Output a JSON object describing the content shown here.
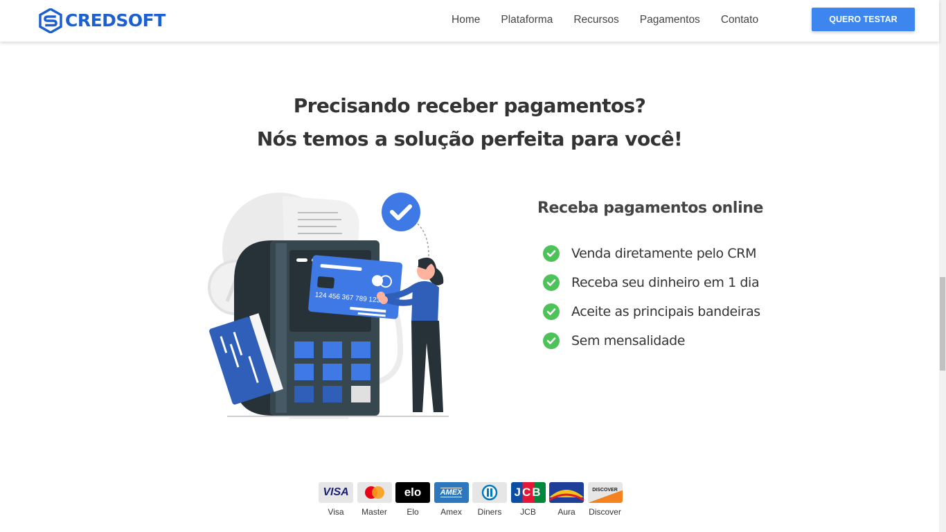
{
  "header": {
    "logo_text": "CREDSOFT",
    "nav": [
      "Home",
      "Plataforma",
      "Recursos",
      "Pagamentos",
      "Contato"
    ],
    "cta_label": "QUERO TESTAR"
  },
  "hero": {
    "line1": "Precisando receber pagamentos?",
    "line2": "Nós temos a solução perfeita para você!"
  },
  "illustration": {
    "card_number": "124 456 367 789 123"
  },
  "features": {
    "title": "Receba pagamentos online",
    "items": [
      "Venda diretamente pelo CRM",
      "Receba seu dinheiro em 1 dia",
      "Aceite as principais bandeiras",
      "Sem mensalidade"
    ]
  },
  "brands": {
    "items": [
      {
        "name": "Visa",
        "logo_text": "VISA"
      },
      {
        "name": "Master",
        "logo_text": ""
      },
      {
        "name": "Elo",
        "logo_text": "elo"
      },
      {
        "name": "Amex",
        "logo_text": "AMEX"
      },
      {
        "name": "Diners",
        "logo_text": ""
      },
      {
        "name": "JCB",
        "logo_text": "JCB"
      },
      {
        "name": "Aura",
        "logo_text": ""
      },
      {
        "name": "Discover",
        "logo_text": "DISCOVER"
      }
    ]
  },
  "colors": {
    "brand_blue": "#1b5fd1",
    "cta_blue": "#3d86f0",
    "check_green": "#4cc259",
    "illustration_blue": "#3e79e6",
    "terminal_dark": "#37474f"
  }
}
